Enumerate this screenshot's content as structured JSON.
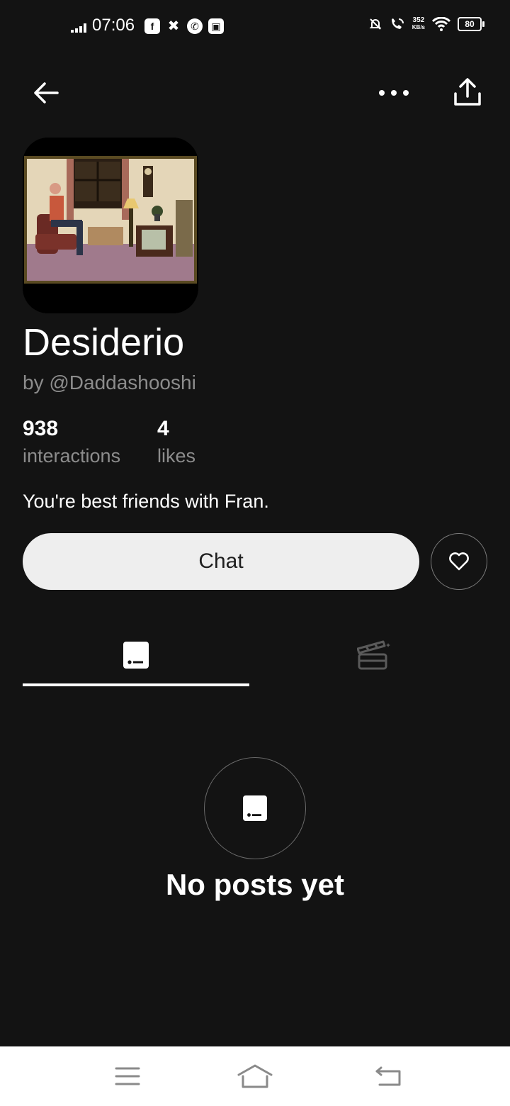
{
  "status_bar": {
    "time": "07:06",
    "app_icons": [
      "facebook-icon",
      "app-icon",
      "whatsapp-icon",
      "app-icon"
    ],
    "network_speed_value": "352",
    "network_speed_unit": "KB/s",
    "battery": "80"
  },
  "profile": {
    "name": "Desiderio",
    "author": "by @Daddashooshi",
    "interactions_count": "938",
    "interactions_label": "interactions",
    "likes_count": "4",
    "likes_label": "likes",
    "description": "You're best friends with Fran."
  },
  "actions": {
    "chat_label": "Chat"
  },
  "tabs": [
    {
      "name": "posts",
      "icon": "post-icon",
      "active": true
    },
    {
      "name": "media",
      "icon": "clapperboard-icon",
      "active": false
    }
  ],
  "empty_state": {
    "message": "No posts yet"
  },
  "colors": {
    "background": "#131313",
    "muted_text": "#8c8c8c",
    "chat_button_bg": "#eeeeee"
  }
}
